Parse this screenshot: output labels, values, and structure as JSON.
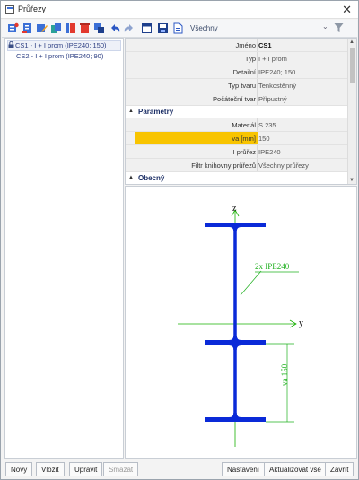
{
  "window": {
    "title": "Průřezy",
    "close_glyph": "✕"
  },
  "toolbar": {
    "buttons": [
      "new-section-icon",
      "import-icon",
      "edit-icon",
      "copy-icon",
      "library-icon",
      "delete-icon",
      "clone-icon",
      "undo-icon",
      "redo-icon",
      "table-icon",
      "save-icon",
      "document-icon"
    ],
    "filter_value": "Všechny",
    "filter_arrow": "⌄"
  },
  "tree": {
    "items": [
      {
        "label": "CS1 - I + I prom (IPE240; 150)",
        "locked": true,
        "selected": true
      },
      {
        "label": "CS2 - I + I prom (IPE240; 90)",
        "locked": false,
        "selected": false
      }
    ]
  },
  "properties": {
    "rows": [
      {
        "label": "Jméno",
        "value": "CS1"
      },
      {
        "label": "Typ",
        "value": "I + I prom"
      },
      {
        "label": "Detailní",
        "value": "IPE240; 150"
      },
      {
        "label": "Typ tvaru",
        "value": "Tenkostěnný"
      },
      {
        "label": "Počáteční tvar",
        "value": "Přípustný"
      }
    ],
    "section_params": "Parametry",
    "param_rows": [
      {
        "label": "Materiál",
        "value": "S 235"
      },
      {
        "label": "va [mm]",
        "value": "150"
      },
      {
        "label": "I průřez",
        "value": "IPE240"
      },
      {
        "label": "Filtr knihovny průřezů",
        "value": "Všechny průřezy"
      }
    ],
    "section_general": "Obecný",
    "toggle_open": "▲",
    "toggle_closed": "▲"
  },
  "preview": {
    "z_label": "z",
    "y_label": "y",
    "profile_label": "2x IPE240",
    "dim_label": "va 150",
    "colors": {
      "section": "#0a2ad8",
      "axis": "#16b000",
      "annot": "#1fb01f"
    }
  },
  "footer": {
    "new": "Nový",
    "insert": "Vložit",
    "edit": "Upravit",
    "delete": "Smazat",
    "settings": "Nastavení",
    "refresh": "Aktualizovat vše",
    "close": "Zavřít"
  }
}
